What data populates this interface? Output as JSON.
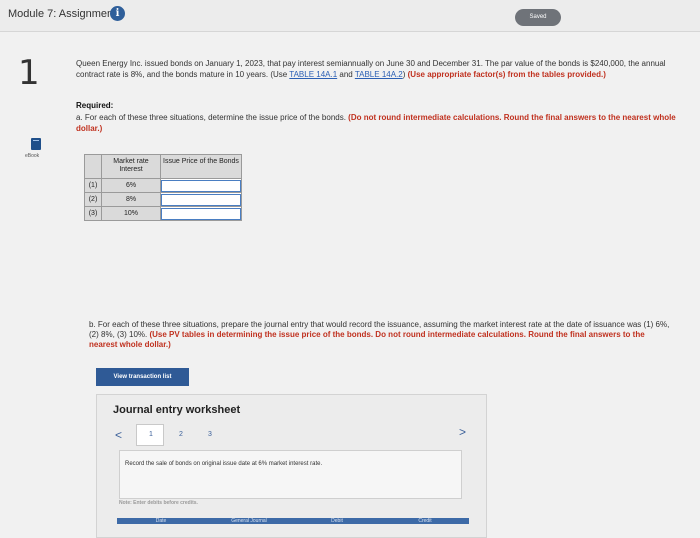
{
  "header": {
    "module_title": "Module 7: Assignment",
    "info_icon": "i",
    "saved_label": "Saved"
  },
  "question": {
    "number": "1",
    "ebook_label": "eBook",
    "intro_text": "Queen Energy Inc. issued bonds on January 1, 2023, that pay interest semiannually on June 30 and December 31. The par value of the bonds is $240,000, the annual contract rate is 8%, and the bonds mature in 10 years. (Use ",
    "link1": "TABLE 14A.1",
    "and_text": " and ",
    "link2": "TABLE 14A.2",
    "close_paren": ")",
    "intro_red": " (Use appropriate factor(s) from the tables provided.)",
    "required_label": "Required:",
    "part_a_text": "a. For each of these three situations, determine the issue price of the bonds.",
    "part_a_red": " (Do not round intermediate calculations. Round the final answers to the nearest whole dollar.)"
  },
  "table": {
    "col1_header": "Market rate Interest",
    "col2_header": "Issue Price of the Bonds",
    "rows": [
      {
        "label": "(1)",
        "rate": "6%",
        "price": ""
      },
      {
        "label": "(2)",
        "rate": "8%",
        "price": ""
      },
      {
        "label": "(3)",
        "rate": "10%",
        "price": ""
      }
    ]
  },
  "part_b": {
    "text": "b. For each of these three situations, prepare the journal entry that would record the issuance, assuming the market interest rate at the date of issuance was (1) 6%, (2) 8%, (3) 10%.",
    "red": " (Use PV tables in determining the issue price of the bonds. Do not round intermediate calculations. Round the final answers to the nearest whole dollar.)"
  },
  "view_transaction_button": "View transaction list",
  "worksheet": {
    "title": "Journal entry worksheet",
    "prev_arrow": "<",
    "next_arrow": ">",
    "pages": [
      "1",
      "2",
      "3"
    ],
    "record_text": "Record the sale of bonds on original issue date at 6% market interest rate.",
    "note": "Note: Enter debits before credits.",
    "tabs": [
      "Date",
      "General Journal",
      "Debit",
      "Credit"
    ]
  }
}
